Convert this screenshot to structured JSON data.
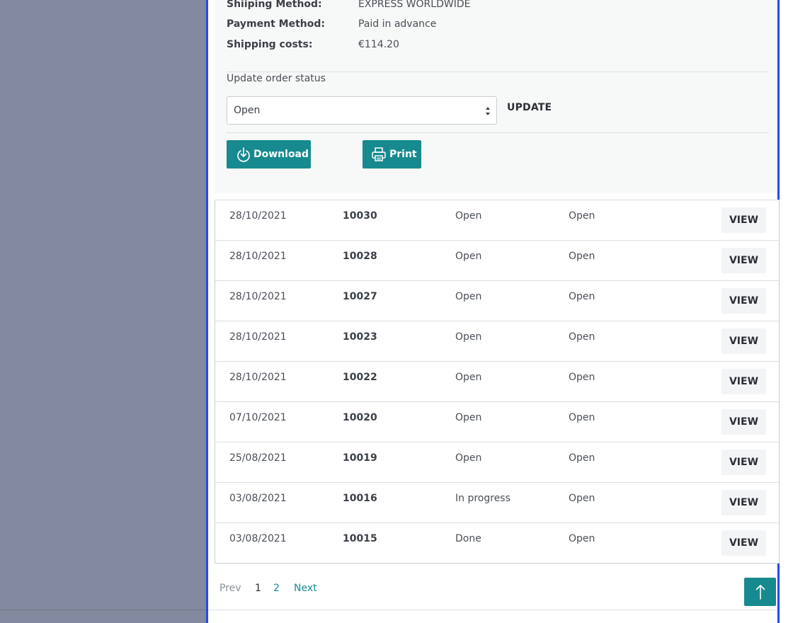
{
  "details": {
    "rows": [
      {
        "label": "Shiiping Method:",
        "value": "EXPRESS WORLDWIDE"
      },
      {
        "label": "Payment Method:",
        "value": "Paid in advance"
      },
      {
        "label": "Shipping costs:",
        "value": "€114.20"
      }
    ],
    "update_label": "Update order status",
    "status_select": {
      "value": "Open"
    },
    "update_button": "UPDATE",
    "download_button": "Download",
    "print_button": "Print"
  },
  "orders": [
    {
      "date": "28/10/2021",
      "id": "10030",
      "status": "Open",
      "payment": "Open",
      "action": "VIEW"
    },
    {
      "date": "28/10/2021",
      "id": "10028",
      "status": "Open",
      "payment": "Open",
      "action": "VIEW"
    },
    {
      "date": "28/10/2021",
      "id": "10027",
      "status": "Open",
      "payment": "Open",
      "action": "VIEW"
    },
    {
      "date": "28/10/2021",
      "id": "10023",
      "status": "Open",
      "payment": "Open",
      "action": "VIEW"
    },
    {
      "date": "28/10/2021",
      "id": "10022",
      "status": "Open",
      "payment": "Open",
      "action": "VIEW"
    },
    {
      "date": "07/10/2021",
      "id": "10020",
      "status": "Open",
      "payment": "Open",
      "action": "VIEW"
    },
    {
      "date": "25/08/2021",
      "id": "10019",
      "status": "Open",
      "payment": "Open",
      "action": "VIEW"
    },
    {
      "date": "03/08/2021",
      "id": "10016",
      "status": "In progress",
      "payment": "Open",
      "action": "VIEW"
    },
    {
      "date": "03/08/2021",
      "id": "10015",
      "status": "Done",
      "payment": "Open",
      "action": "VIEW"
    }
  ],
  "pagination": {
    "prev": "Prev",
    "pages": [
      "1",
      "2"
    ],
    "current": "1",
    "next": "Next"
  },
  "icons": {
    "download": "download-icon",
    "print": "printer-icon",
    "scroll_top": "arrow-up-icon"
  },
  "colors": {
    "accent": "#178a8f",
    "frame": "#2b47e8",
    "backdrop": "#838a9f"
  }
}
